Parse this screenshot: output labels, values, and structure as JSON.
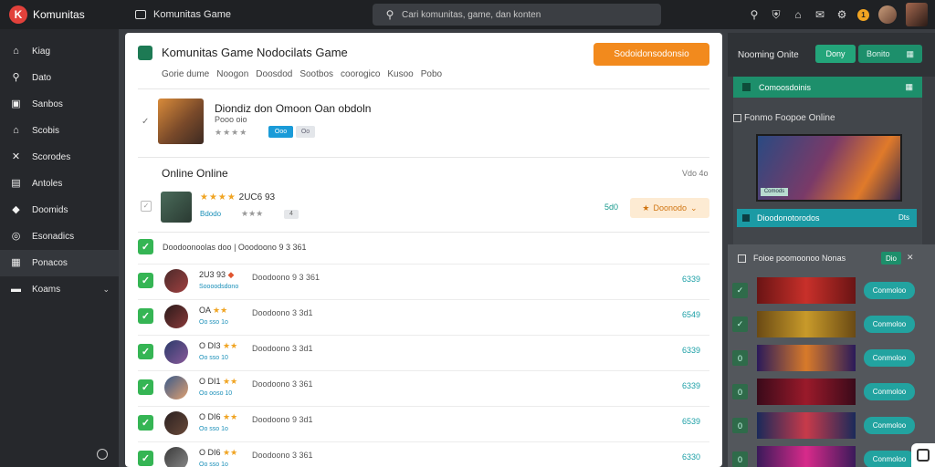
{
  "app": {
    "name": "Komunitas",
    "logo_letter": "K"
  },
  "header": {
    "page_title": "Komunitas Game",
    "search_placeholder": "Cari komunitas, game, dan konten",
    "notification_count": "1"
  },
  "sidebar": {
    "items": [
      {
        "label": "Kiag",
        "icon": "home-icon"
      },
      {
        "label": "Dato",
        "icon": "search-icon"
      },
      {
        "label": "Sanbos",
        "icon": "bookmark-icon"
      },
      {
        "label": "Scobis",
        "icon": "library-icon"
      },
      {
        "label": "Scorodes",
        "icon": "shuffle-icon"
      },
      {
        "label": "Antoles",
        "icon": "document-icon"
      },
      {
        "label": "Doomids",
        "icon": "chat-icon"
      },
      {
        "label": "Esonadics",
        "icon": "compass-icon"
      },
      {
        "label": "Ponacos",
        "icon": "gamepad-icon",
        "active": true
      },
      {
        "label": "Koams",
        "icon": "folder-icon",
        "expandable": true
      }
    ]
  },
  "panel": {
    "title": "Komunitas Game Nodocilats Game",
    "primary_button": "Sodoidonsodonsio",
    "breadcrumbs": [
      "Gorie dume",
      "Noogon",
      "Doosdod",
      "Sootbos",
      "coorogico",
      "Kusoo",
      "Pobo"
    ],
    "featured": {
      "title": "Diondiz don Omoon Oan obdoln",
      "subtitle": "Pooo oio",
      "chip_primary": "Ooo",
      "chip_secondary": "Oo"
    },
    "section": {
      "title": "Online Online",
      "meta": "Vdo 4o"
    },
    "highlight": {
      "rating": "2UC6 93",
      "meta": "Bdodo",
      "count": "4",
      "price": "5d0",
      "button": "Doonodo"
    },
    "list_header": "Doodoonoolas doo | Ooodoono 9 3 361",
    "rows": [
      {
        "rating": "2U3 93",
        "sub": "Soooodsdono",
        "desc": "Doodoono 9 3 361",
        "price": "6339"
      },
      {
        "rating": "OA",
        "sub": "Oo sso 1o",
        "desc": "Doodoono 3 3d1",
        "price": "6549"
      },
      {
        "rating": "O DI3",
        "sub": "Oo sso 10",
        "desc": "Doodoono 3 3d1",
        "price": "6339"
      },
      {
        "rating": "O DI1",
        "sub": "Oo ooso 10",
        "desc": "Doodoono 3 361",
        "price": "6339"
      },
      {
        "rating": "O DI6",
        "sub": "Oo sso 1o",
        "desc": "Doodoono 9 3d1",
        "price": "6539"
      },
      {
        "rating": "O DI6",
        "sub": "Oo sso 1o",
        "desc": "Doodoono 3 361",
        "price": "6330"
      }
    ]
  },
  "right": {
    "header_title": "Nooming Onite",
    "tab_primary": "Dony",
    "tab_secondary": "Bonito",
    "green_bar": "Comoosdoinis",
    "card_title": "Fonmo Foopoe Online",
    "hero_tag": "Comods",
    "teal_bar": "Dioodonotorodos",
    "teal_bar_end": "Dts",
    "list_title": "Foioe poomoonoo Nonas",
    "list_tag": "Dio",
    "items_button": "Conmoloo",
    "items": [
      {
        "check": "✓",
        "thumb_colors": [
          "#6a1414",
          "#c8302a"
        ]
      },
      {
        "check": "✓",
        "thumb_colors": [
          "#6a4a14",
          "#c89a2a"
        ]
      },
      {
        "check": "0",
        "thumb_colors": [
          "#2a1a5a",
          "#d87a2a"
        ]
      },
      {
        "check": "0",
        "thumb_colors": [
          "#3a0a1a",
          "#9a1a2a"
        ]
      },
      {
        "check": "0",
        "thumb_colors": [
          "#1a2a5a",
          "#c83a4a"
        ]
      },
      {
        "check": "0",
        "thumb_colors": [
          "#3a1a5a",
          "#d82a8a"
        ]
      }
    ]
  },
  "colors": {
    "accent_orange": "#f28a1d",
    "accent_green": "#1d8f6b",
    "accent_teal": "#1b9aa4",
    "check_green": "#35b554"
  }
}
